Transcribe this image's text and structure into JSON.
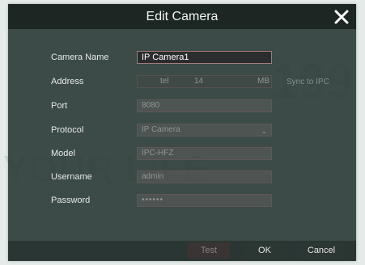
{
  "dialog": {
    "title": "Edit Camera",
    "close_icon": "close-x-icon"
  },
  "watermark": {
    "text_life": "YOUR LIFE",
    "text_num": "199"
  },
  "form": {
    "camera_name": {
      "label": "Camera Name",
      "value": "IP Camera1"
    },
    "address": {
      "label": "Address",
      "segment1": "tel",
      "segment2": "14",
      "segment3": "MB",
      "sync_label": "Sync to IPC"
    },
    "port": {
      "label": "Port",
      "value": "8080"
    },
    "protocol": {
      "label": "Protocol",
      "value": "IP Camera"
    },
    "model": {
      "label": "Model",
      "value": "IPC-HFZ"
    },
    "username": {
      "label": "Username",
      "value": "admin"
    },
    "password": {
      "label": "Password",
      "value": "••••••"
    }
  },
  "footer": {
    "test_label": "Test",
    "ok_label": "OK",
    "cancel_label": "Cancel"
  },
  "colors": {
    "dialog_bg": "#293a35",
    "title_bar": "#18221f",
    "field_border": "#a67a7a",
    "text": "#e7e9e8"
  }
}
